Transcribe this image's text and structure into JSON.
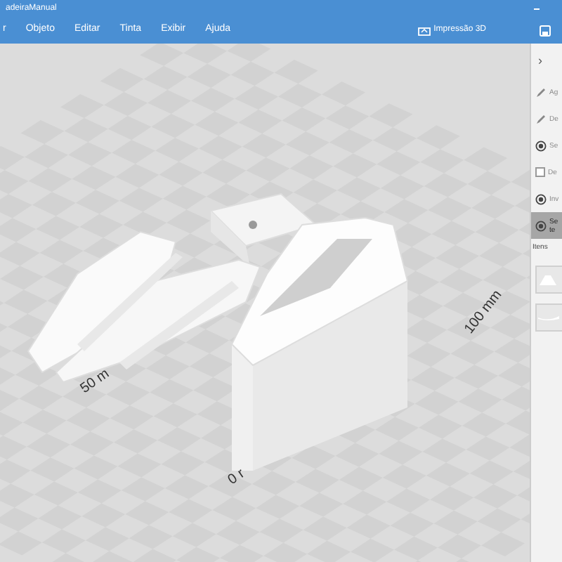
{
  "window": {
    "title": "adeiraManual"
  },
  "menu": [
    {
      "label": "r"
    },
    {
      "label": "Objeto"
    },
    {
      "label": "Editar"
    },
    {
      "label": "Tinta"
    },
    {
      "label": "Exibir"
    },
    {
      "label": "Ajuda"
    }
  ],
  "toolbar": {
    "print_label": "Impressão 3D"
  },
  "viewport": {
    "axis_labels": [
      {
        "text": "100 mm"
      },
      {
        "text": "50 m"
      },
      {
        "text": "0 r"
      }
    ]
  },
  "side_panel": {
    "expand_glyph": "›",
    "items": [
      {
        "kind": "action",
        "label": "Ag",
        "selected": false
      },
      {
        "kind": "action",
        "label": "De",
        "selected": false
      },
      {
        "kind": "radio",
        "label": "Se",
        "selected": false
      },
      {
        "kind": "checkbox",
        "label": "De",
        "checked": false,
        "selected": false
      },
      {
        "kind": "radio",
        "label": "Inv",
        "selected": false
      },
      {
        "kind": "radio",
        "label": "Se te",
        "selected": true
      }
    ],
    "section_title": "Itens"
  }
}
